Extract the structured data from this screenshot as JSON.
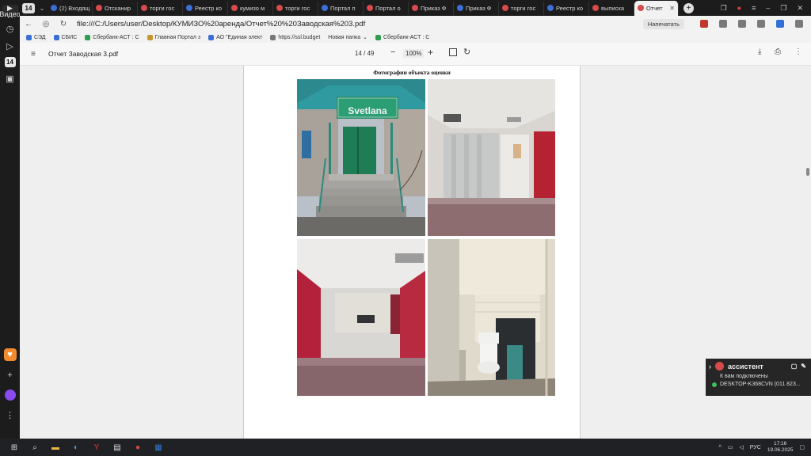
{
  "sidebar": {
    "badge_top": "Видео",
    "badge_num": "14"
  },
  "tabs": {
    "count": "14",
    "items": [
      {
        "label": "(2) Входящ",
        "color": "#3b6fd6"
      },
      {
        "label": "Отсканир",
        "color": "#d94a4a"
      },
      {
        "label": "торги гос",
        "color": "#d94a4a"
      },
      {
        "label": "Реестр ко",
        "color": "#3b6fd6"
      },
      {
        "label": "кумизо м",
        "color": "#d94a4a"
      },
      {
        "label": "торги гос",
        "color": "#d94a4a"
      },
      {
        "label": "Портал п",
        "color": "#3b6fd6"
      },
      {
        "label": "Портал о",
        "color": "#d94a4a"
      },
      {
        "label": "Приказ Ф",
        "color": "#d94a4a"
      },
      {
        "label": "Приказ Ф",
        "color": "#3b6fd6"
      },
      {
        "label": "торги гос",
        "color": "#d94a4a"
      },
      {
        "label": "Реестр ко",
        "color": "#3b6fd6"
      },
      {
        "label": "выписка",
        "color": "#d94a4a"
      }
    ],
    "active": {
      "label": "Отчет",
      "color": "#d94a4a"
    }
  },
  "address": {
    "url": "file:///C:/Users/user/Desktop/КУМИЗО%20аренда/Отчет%20%20Заводская%203.pdf",
    "print_label": "Напечатать"
  },
  "bookmarks": [
    {
      "label": "СЭД",
      "color": "#3b6fd6"
    },
    {
      "label": "СБИС",
      "color": "#3b6fd6"
    },
    {
      "label": "Сбербанк-АСТ : С",
      "color": "#2f9e4f"
    },
    {
      "label": "Главная Портал з",
      "color": "#c8962e"
    },
    {
      "label": "АО \"Единая элект",
      "color": "#3b6fd6"
    },
    {
      "label": "https://ssl.budget",
      "color": "#777777"
    },
    {
      "label": "Новая папка",
      "color": "#777777"
    },
    {
      "label": "Сбербанк-АСТ : С",
      "color": "#2f9e4f"
    }
  ],
  "pdf": {
    "title": "Отчет Заводская 3.pdf",
    "page": "14 / 49",
    "zoom": "100%",
    "page_heading": "Фотографии объекта оценки",
    "sign_text": "Svetlana"
  },
  "assistant": {
    "title": "ассистент",
    "line1": "К вам подключены",
    "line2": "DESKTOP-K368CVN (011 823..."
  },
  "taskbar": {
    "lang": "РУС",
    "time": "17:16",
    "date": "19.06.2025"
  }
}
